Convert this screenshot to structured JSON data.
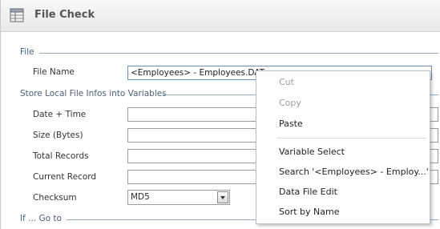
{
  "window": {
    "title": "File Check"
  },
  "sections": {
    "file": "File",
    "store": "Store Local File Infos into Variables",
    "ifgoto": "If ... Go to"
  },
  "fields": {
    "file_name": {
      "label": "File Name",
      "value": "<Employees> - Employees.DAT"
    },
    "date_time": {
      "label": "Date + Time",
      "value": ""
    },
    "size": {
      "label": "Size (Bytes)",
      "value": ""
    },
    "total_records": {
      "label": "Total Records",
      "value": ""
    },
    "current_record": {
      "label": "Current Record",
      "value": ""
    },
    "checksum": {
      "label": "Checksum",
      "value": "MD5"
    }
  },
  "context_menu": {
    "cut": "Cut",
    "copy": "Copy",
    "paste": "Paste",
    "variable_select": "Variable Select",
    "search": "Search '<Employees> - Employ...'",
    "data_file_edit": "Data File Edit",
    "sort_by_name": "Sort by Name"
  },
  "icons": {
    "title_icon": "table-grid-icon"
  }
}
